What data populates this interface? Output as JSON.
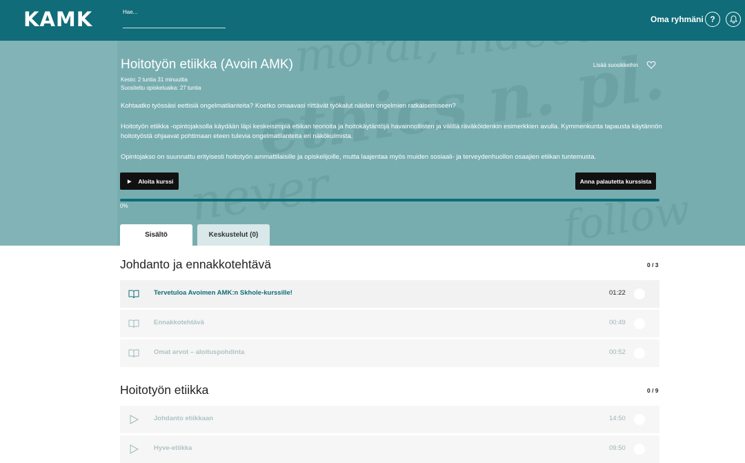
{
  "header": {
    "logo": "KAMK",
    "search_placeholder": "Hae...",
    "group_link": "Oma ryhmäni",
    "help_label": "?",
    "colors": {
      "brand": "#0f6c78"
    }
  },
  "course": {
    "title": "Hoitotyön etiikka (Avoin AMK)",
    "favorite_label": "Lisää suosikkeihin",
    "duration": "Kesto: 2 tuntia 31 minuuttia",
    "recommended_time": "Suositeltu opiskeluaika: 27 tuntia",
    "description_1": "Kohtaatko työssäsi eettisiä ongelmatilanteita? Koetko omaavasi riittävät työkalut näiden ongelmien ratkaisemiseen?",
    "description_2": "Hoitotyön etiikka -opintojaksolla käydään läpi keskeisimpiä etiikan teorioita ja hoitokäytäntöjä havainnollisten ja välillä räväköidenkin esimerkkien avulla. Kymmenkunta tapausta käytännön hoitotyöstä ohjaavat pohtimaan eteen tulevia ongelmatilanteita eri näkökulmista.",
    "description_3": "Opintojakso on suunnattu erityisesti hoitotyön ammattilaisille ja opiskelijoille, mutta laajentaa myös muiden sosiaali- ja terveydenhuollon osaajien etiikan tuntemusta.",
    "start_button": "Aloita kurssi",
    "feedback_button": "Anna palautetta kurssista",
    "progress_value": 0,
    "progress_text": "0%"
  },
  "tabs": [
    {
      "label": "Sisältö"
    },
    {
      "label": "Keskustelut (0)"
    }
  ],
  "sections": [
    {
      "title": "Johdanto ja ennakkotehtävä",
      "count": "0 / 3",
      "items": [
        {
          "label": "Tervetuloa Avoimen AMK:n Skhole-kurssille!",
          "duration": "01:22",
          "icon": "book-icon"
        },
        {
          "label": "Ennakkotehtävä",
          "duration": "00:49",
          "icon": "book-icon"
        },
        {
          "label": "Omat arvot – aloituspohdinta",
          "duration": "00:52",
          "icon": "book-icon"
        }
      ]
    },
    {
      "title": "Hoitotyön etiikka",
      "count": "0 / 9",
      "items": [
        {
          "label": "Johdanto etiikkaan",
          "duration": "14:50",
          "icon": "play-icon"
        },
        {
          "label": "Hyve-etiikka",
          "duration": "09:50",
          "icon": "play-icon"
        }
      ]
    }
  ]
}
